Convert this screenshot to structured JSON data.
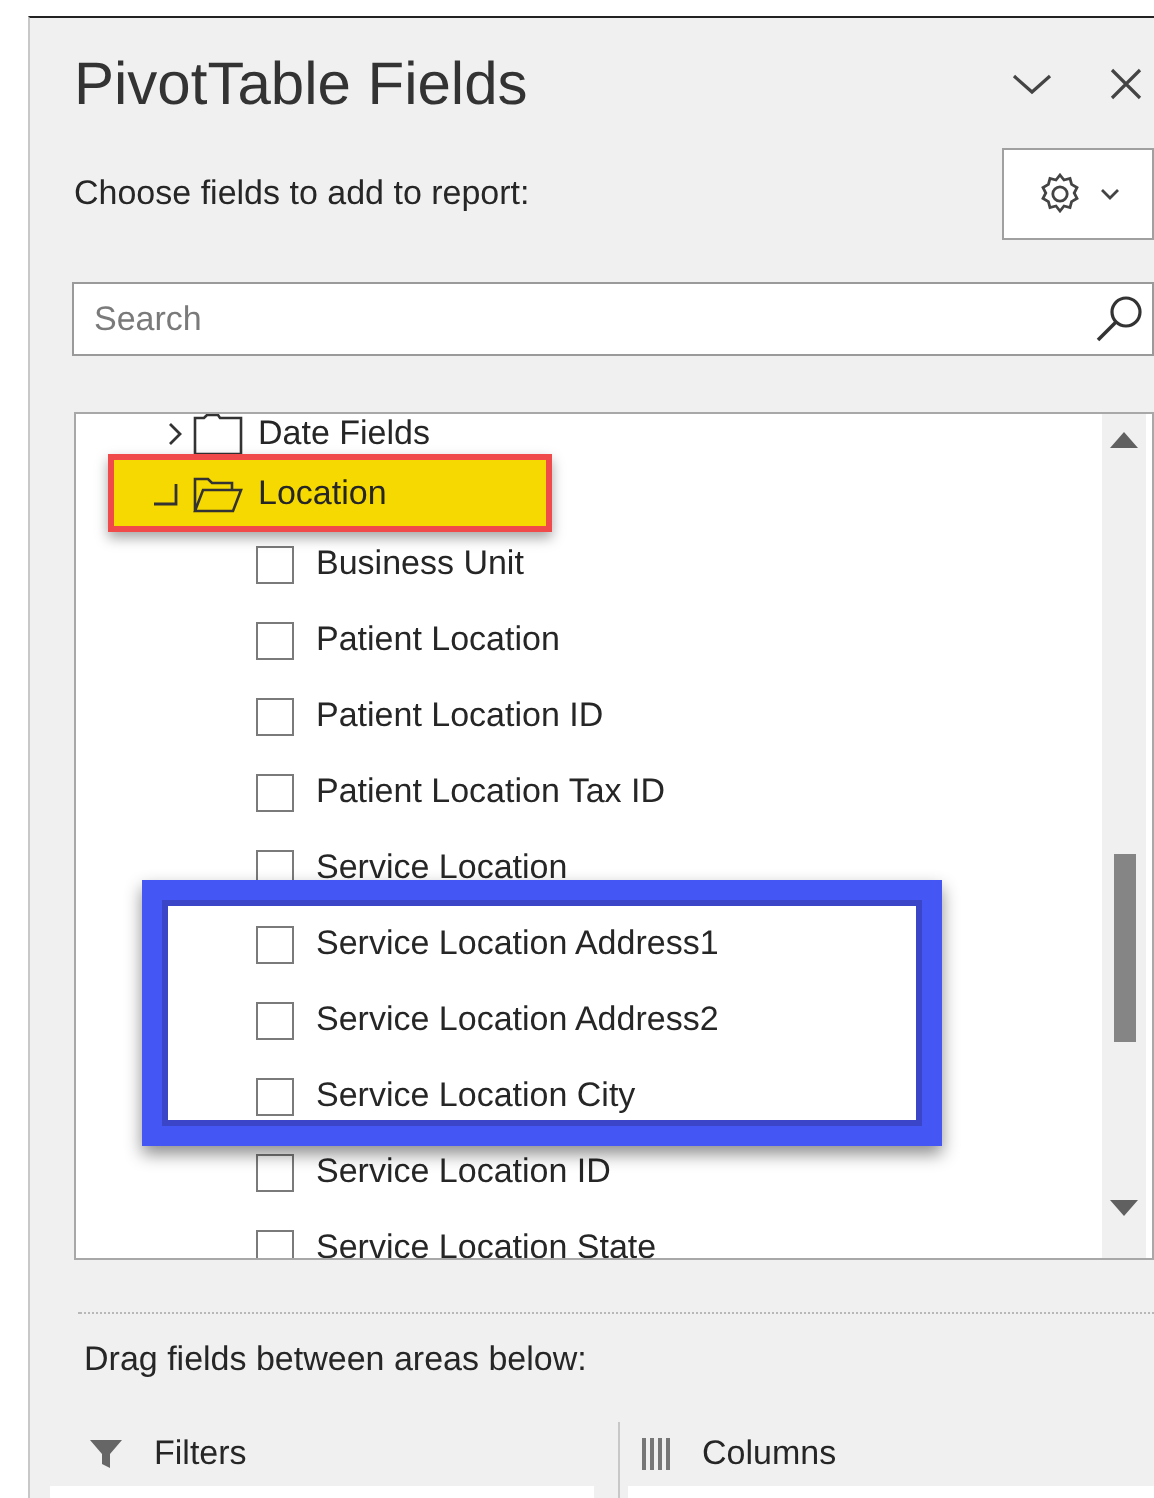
{
  "panel": {
    "title": "PivotTable Fields",
    "subtitle": "Choose fields to add to report:",
    "search": {
      "placeholder": "Search"
    }
  },
  "fields": [
    {
      "kind": "folder",
      "label": "Date Fields",
      "expanded": false,
      "highlighted": false
    },
    {
      "kind": "folder",
      "label": "Location",
      "expanded": true,
      "highlighted": true,
      "children": [
        {
          "label": "Business Unit",
          "checked": false,
          "boxed": false
        },
        {
          "label": "Patient Location",
          "checked": false,
          "boxed": false
        },
        {
          "label": "Patient Location ID",
          "checked": false,
          "boxed": false
        },
        {
          "label": "Patient Location Tax ID",
          "checked": false,
          "boxed": false
        },
        {
          "label": "Service Location",
          "checked": false,
          "boxed": false
        },
        {
          "label": "Service Location Address1",
          "checked": false,
          "boxed": true
        },
        {
          "label": "Service Location Address2",
          "checked": false,
          "boxed": true
        },
        {
          "label": "Service Location City",
          "checked": false,
          "boxed": true
        },
        {
          "label": "Service Location ID",
          "checked": false,
          "boxed": false
        },
        {
          "label": "Service Location State",
          "checked": false,
          "boxed": false
        }
      ]
    }
  ],
  "areas_hint": "Drag fields between areas below:",
  "areas": [
    {
      "kind": "filters",
      "label": "Filters"
    },
    {
      "kind": "columns",
      "label": "Columns"
    }
  ]
}
